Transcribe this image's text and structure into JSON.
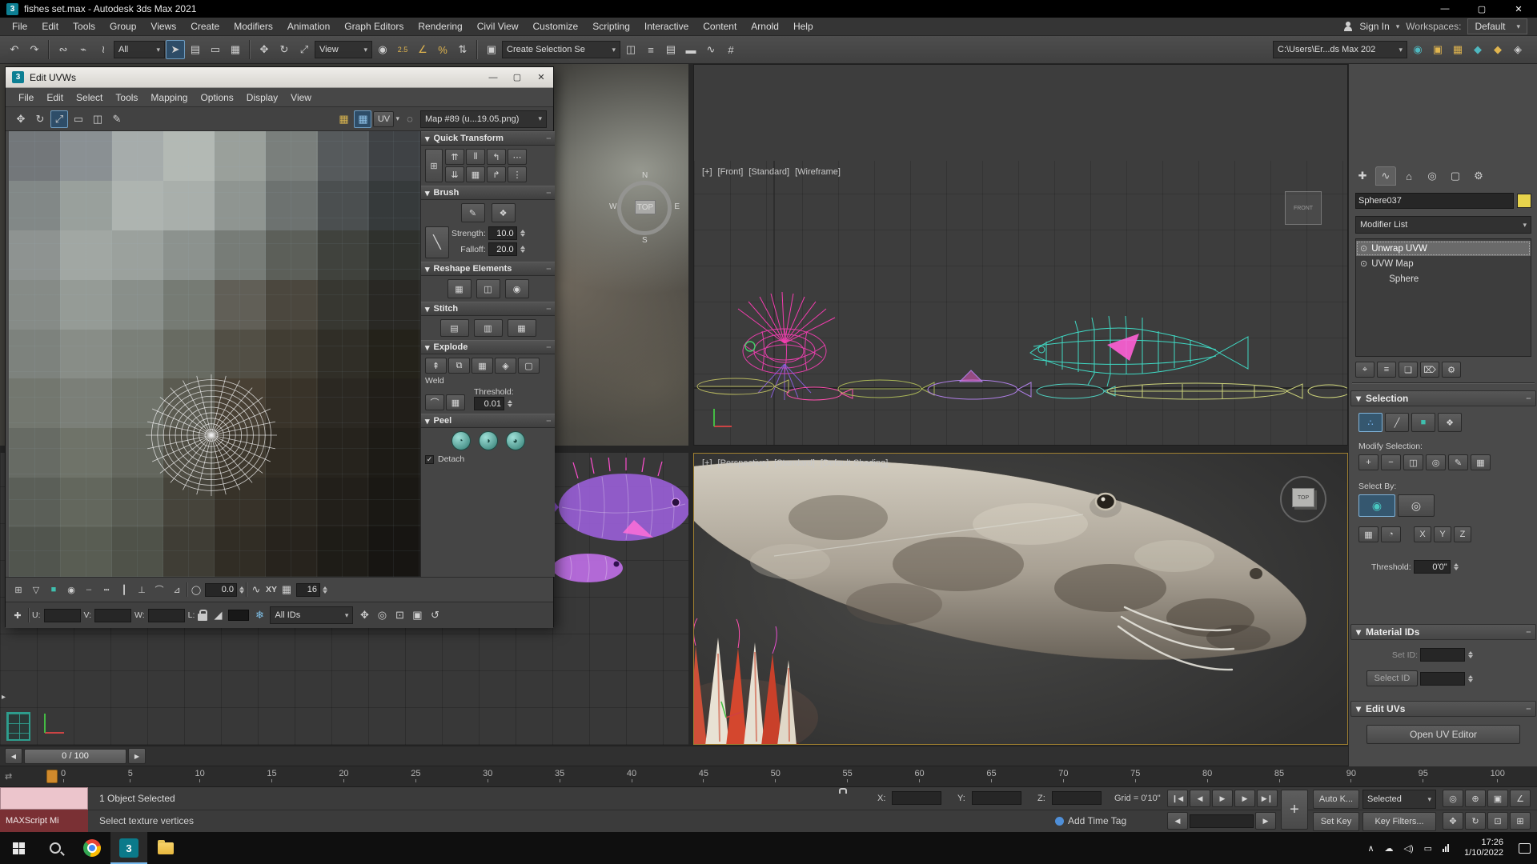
{
  "ui": {
    "caret": "▾",
    "collapse": "▾",
    "grip": "┉",
    "check": "✓",
    "pipe": "|",
    "ruler_grip": "⇄",
    "plus": "+"
  },
  "titlebar": {
    "logo_badge": "3",
    "app_title": "fishes set.max - Autodesk 3ds Max 2021",
    "controls": [
      {
        "name": "minimize-button",
        "glyph": "—"
      },
      {
        "name": "maximize-button",
        "glyph": "▢"
      },
      {
        "name": "close-button",
        "glyph": "✕"
      }
    ]
  },
  "menubar": {
    "items": [
      "File",
      "Edit",
      "Tools",
      "Group",
      "Views",
      "Create",
      "Modifiers",
      "Animation",
      "Graph Editors",
      "Rendering",
      "Civil View",
      "Customize",
      "Scripting",
      "Interactive",
      "Content",
      "Arnold",
      "Help"
    ],
    "sign_in": "Sign In",
    "workspaces_label": "Workspaces:",
    "workspace_value": "Default"
  },
  "main_toolbar": {
    "s1": [
      {
        "name": "undo-icon",
        "glyph": "↶"
      },
      {
        "name": "redo-icon",
        "glyph": "↷"
      }
    ],
    "s2": [
      {
        "name": "select-and-link-icon",
        "glyph": "∾"
      },
      {
        "name": "unlink-selection-icon",
        "glyph": "⌁"
      },
      {
        "name": "bind-to-space-warp-icon",
        "glyph": "≀"
      }
    ],
    "filter_value": "All",
    "s3": [
      {
        "name": "select-object-icon",
        "glyph": "➤",
        "active": true
      },
      {
        "name": "select-by-name-icon",
        "glyph": "▤"
      },
      {
        "name": "rectangular-selection-icon",
        "glyph": "▭"
      },
      {
        "name": "window-crossing-icon",
        "glyph": "▦"
      }
    ],
    "s4": [
      {
        "name": "select-and-move-icon",
        "glyph": "✥"
      },
      {
        "name": "select-and-rotate-icon",
        "glyph": "↻"
      },
      {
        "name": "select-and-scale-icon",
        "glyph": "⤢"
      }
    ],
    "coord_value": "View",
    "s5": [
      {
        "name": "use-pivot-center-icon",
        "glyph": "◉"
      },
      {
        "name": "snap-toggle-icon",
        "glyph": "2.5",
        "small": true,
        "color": "#e0b54f"
      },
      {
        "name": "angle-snap-icon",
        "glyph": "∠",
        "color": "#e0b54f"
      },
      {
        "name": "percent-snap-icon",
        "glyph": "%",
        "color": "#e0b54f"
      },
      {
        "name": "spinner-snap-icon",
        "glyph": "⇅"
      }
    ],
    "s6": [
      {
        "name": "edit-named-selections-icon",
        "glyph": "▣"
      }
    ],
    "named_selection_value": "Create Selection Se",
    "s7": [
      {
        "name": "mirror-icon",
        "glyph": "◫"
      },
      {
        "name": "align-icon",
        "glyph": "≡"
      },
      {
        "name": "layer-manager-icon",
        "glyph": "▤"
      },
      {
        "name": "toggle-ribbon-icon",
        "glyph": "▬"
      },
      {
        "name": "curve-editor-icon",
        "glyph": "∿"
      },
      {
        "name": "schematic-view-icon",
        "glyph": "#"
      }
    ],
    "project_path": "C:\\Users\\Er...ds Max 202",
    "s8": [
      {
        "name": "material-editor-icon",
        "glyph": "◉",
        "color": "#4fb8c0"
      },
      {
        "name": "render-setup-icon",
        "glyph": "▣",
        "color": "#e0b54f"
      },
      {
        "name": "rendered-frame-icon",
        "glyph": "▦",
        "color": "#e0b54f"
      },
      {
        "name": "render-production-icon",
        "glyph": "◆",
        "color": "#4fb8c0"
      },
      {
        "name": "render-iterative-icon",
        "glyph": "◆",
        "color": "#e0b54f"
      },
      {
        "name": "open-arnold-icon",
        "glyph": "◈"
      }
    ]
  },
  "viewports": {
    "front_tokens": [
      "[+]",
      "[Front]",
      "[Standard]",
      "[Wireframe]"
    ],
    "persp_tokens": [
      "[+]",
      "[Perspective]",
      "[Standard]",
      "[Default Shading]"
    ],
    "compass": {
      "n": "N",
      "e": "E",
      "s": "S",
      "w": "W",
      "hub": "TOP"
    },
    "viewcube_front": "FRONT",
    "viewcube_top": "TOP"
  },
  "uv_canvas": {
    "pixels": [
      "#73777a",
      "#8a9093",
      "#a6acab",
      "#b3b9b4",
      "#9aa09b",
      "#7a7f7c",
      "#565a5c",
      "#3f4245",
      "#828887",
      "#99a09c",
      "#aeb4b0",
      "#a9afab",
      "#8f9591",
      "#6d7270",
      "#4b4f50",
      "#363a3b",
      "#8e9391",
      "#a1a7a3",
      "#9ba19d",
      "#8c928e",
      "#777c77",
      "#5c5f59",
      "#40423d",
      "#2f312d",
      "#868b87",
      "#959b96",
      "#898f8a",
      "#767b74",
      "#615f57",
      "#4b473e",
      "#373731",
      "#292824",
      "#7d827d",
      "#888d87",
      "#7b8079",
      "#686b62",
      "#524f45",
      "#413d33",
      "#302e27",
      "#24221a",
      "#73776f",
      "#7b7f78",
      "#6f736a",
      "#5b5b51",
      "#484034",
      "#393329",
      "#2b2822",
      "#211e19",
      "#676b64",
      "#6f7369",
      "#63665d",
      "#4f4d43",
      "#3e382d",
      "#312c23",
      "#26231d",
      "#1d1b16",
      "#5b5f58",
      "#63675d",
      "#585b52",
      "#46443b",
      "#373229",
      "#2b2720",
      "#221f1a",
      "#1a1814",
      "#51554e",
      "#595d53",
      "#4f5249",
      "#3f3d35",
      "#312d25",
      "#27231d",
      "#1e1c17",
      "#171512"
    ]
  },
  "uv_editor": {
    "window_title": "Edit UVWs",
    "logo_badge": "3",
    "window_controls": [
      {
        "name": "uvw-minimize-button",
        "glyph": "—"
      },
      {
        "name": "uvw-maximize-button",
        "glyph": "▢"
      },
      {
        "name": "uvw-close-button",
        "glyph": "✕"
      }
    ],
    "menu_items": [
      "File",
      "Edit",
      "Select",
      "Tools",
      "Mapping",
      "Options",
      "Display",
      "View"
    ],
    "toolbar": {
      "left_icons": [
        {
          "name": "uv-move-icon",
          "glyph": "✥"
        },
        {
          "name": "uv-rotate-icon",
          "glyph": "↻"
        },
        {
          "name": "uv-scale-icon",
          "glyph": "⤢",
          "active": true
        },
        {
          "name": "uv-freeform-icon",
          "glyph": "▭"
        },
        {
          "name": "uv-mirror-icon",
          "glyph": "◫"
        },
        {
          "name": "uv-brush-icon",
          "glyph": "✎"
        }
      ],
      "right_icons": [
        {
          "name": "show-map-icon",
          "glyph": "▦",
          "color": "#d8b44f"
        },
        {
          "name": "snap-grid-icon",
          "glyph": "▦",
          "active": true,
          "color": "#8fc2e8"
        }
      ],
      "uv_button": "UV",
      "lasso_glyph": "◌",
      "map_value": "Map #89 (u...19.05.png)"
    },
    "rollouts": {
      "quick_transform": {
        "title": "Quick Transform",
        "tool_button": {
          "name": "align-selector-button",
          "glyph": "⊞"
        },
        "buttons": [
          {
            "name": "align-horizontal-button",
            "glyph": "⇈"
          },
          {
            "name": "space-horizontal-button",
            "glyph": "⫴"
          },
          {
            "name": "rotate-ccw-button",
            "glyph": "↰"
          },
          {
            "name": "linear-align-h-button",
            "glyph": "⋯"
          },
          {
            "name": "align-vertical-button",
            "glyph": "⇊"
          },
          {
            "name": "space-vertical-button",
            "glyph": "▦"
          },
          {
            "name": "rotate-cw-button",
            "glyph": "↱"
          },
          {
            "name": "linear-align-v-button",
            "glyph": "⋮"
          }
        ]
      },
      "brush": {
        "title": "Brush",
        "buttons": [
          {
            "name": "paint-move-brush-button",
            "glyph": "✎"
          },
          {
            "name": "relax-brush-button",
            "glyph": "❖"
          }
        ],
        "falloff_curve_glyph": "╲",
        "strength_label": "Strength:",
        "strength_value": "10.0",
        "falloff_label": "Falloff:",
        "falloff_value": "20.0"
      },
      "reshape": {
        "title": "Reshape Elements",
        "buttons": [
          {
            "name": "straighten-selection-button",
            "glyph": "▦"
          },
          {
            "name": "make-rectangular-button",
            "glyph": "◫"
          },
          {
            "name": "relax-until-flat-button",
            "glyph": "◉"
          }
        ]
      },
      "stitch": {
        "title": "Stitch",
        "buttons": [
          {
            "name": "stitch-custom-button",
            "glyph": "▤"
          },
          {
            "name": "stitch-to-target-button",
            "glyph": "▥"
          },
          {
            "name": "stitch-to-source-button",
            "glyph": "▦"
          }
        ]
      },
      "explode": {
        "title": "Explode",
        "buttons": [
          {
            "name": "flatten-by-smoothing-button",
            "glyph": "⇞"
          },
          {
            "name": "flatten-by-id-button",
            "glyph": "⧉"
          },
          {
            "name": "flatten-mapping-button",
            "glyph": "▦"
          },
          {
            "name": "explode-to-faces-button",
            "glyph": "◈"
          },
          {
            "name": "break-button",
            "glyph": "▢"
          }
        ],
        "weld_label": "Weld",
        "weld_buttons": [
          {
            "name": "weld-together-button",
            "glyph": "⌒"
          },
          {
            "name": "weld-all-button",
            "glyph": "▦"
          }
        ],
        "threshold_label": "Threshold:",
        "threshold_value": "0.01"
      },
      "peel": {
        "title": "Peel",
        "buttons": [
          {
            "name": "quick-peel-button",
            "glyph": "◔"
          },
          {
            "name": "peel-mode-button",
            "glyph": "◑"
          },
          {
            "name": "edit-seams-button",
            "glyph": "◕"
          }
        ],
        "detach_checked": "✓",
        "detach_label": "Detach"
      }
    },
    "bottom_toolbar": {
      "icons": [
        {
          "name": "soft-selection-icon",
          "glyph": "⊞"
        },
        {
          "name": "falloff-linear-icon",
          "glyph": "▽"
        },
        {
          "name": "falloff-box-icon",
          "glyph": "■",
          "color": "#3fbfae"
        },
        {
          "name": "falloff-smooth-icon",
          "glyph": "◉"
        },
        {
          "name": "edge-distance-icon",
          "glyph": "┄"
        },
        {
          "name": "limit-soft-selection-icon",
          "glyph": "┅"
        },
        {
          "name": "mirror-axis-icon",
          "glyph": "┃"
        },
        {
          "name": "align-perpendicular-icon",
          "glyph": "⊥"
        },
        {
          "name": "arc-mode-icon",
          "glyph": "⌒"
        },
        {
          "name": "angle-mode-icon",
          "glyph": "⊿"
        }
      ],
      "circle_glyph": "◯",
      "angle_value": "0.0",
      "curve_glyph": "∿",
      "axis_label": "XY",
      "grid_glyph": "▦",
      "grid_value": "16"
    },
    "status_row": {
      "move_glyph": "✚",
      "u_label": "U:",
      "u_value": "",
      "v_label": "V:",
      "v_value": "",
      "w_label": "W:",
      "w_value": "",
      "l_label": "L:",
      "gradient_glyph": "◢",
      "snow_glyph": "❄",
      "ids_value": "All IDs",
      "nav_icons": [
        {
          "name": "uv-pan-icon",
          "glyph": "✥"
        },
        {
          "name": "uv-zoom-icon",
          "glyph": "◎"
        },
        {
          "name": "uv-zoom-region-icon",
          "glyph": "⊡"
        },
        {
          "name": "uv-zoom-extents-icon",
          "glyph": "▣"
        },
        {
          "name": "uv-zoom-selected-icon",
          "glyph": "↺"
        }
      ]
    }
  },
  "command_panel": {
    "tabs": [
      {
        "name": "tab-create",
        "glyph": "✚"
      },
      {
        "name": "tab-modify",
        "glyph": "∿",
        "active": true
      },
      {
        "name": "tab-hierarchy",
        "glyph": "⌂"
      },
      {
        "name": "tab-motion",
        "glyph": "◎"
      },
      {
        "name": "tab-display",
        "glyph": "▢"
      },
      {
        "name": "tab-utilities",
        "glyph": "⚙"
      }
    ],
    "object_name": "Sphere037",
    "modifier_list_label": "Modifier List",
    "stack": [
      {
        "name": "stack-row-unwrap-uvw",
        "label": "Unwrap UVW",
        "eye": true,
        "active": true
      },
      {
        "name": "stack-row-uvw-map",
        "label": "UVW Map",
        "eye": true
      },
      {
        "name": "stack-row-sphere",
        "label": "Sphere",
        "indent": true
      }
    ],
    "stack_tools": [
      {
        "name": "pin-stack-icon",
        "glyph": "⌖"
      },
      {
        "name": "show-end-result-icon",
        "glyph": "≡"
      },
      {
        "name": "make-unique-icon",
        "glyph": "❏"
      },
      {
        "name": "remove-modifier-icon",
        "glyph": "⌦"
      },
      {
        "name": "configure-modifier-sets-icon",
        "glyph": "⚙"
      }
    ],
    "selection": {
      "title": "Selection",
      "mode_buttons": [
        {
          "name": "vertex-mode-button",
          "glyph": "∴",
          "active": true,
          "color": "#7fc0ff"
        },
        {
          "name": "edge-mode-button",
          "glyph": "╱"
        },
        {
          "name": "polygon-mode-button",
          "glyph": "■",
          "color": "#3fbfae"
        },
        {
          "name": "element-mode-button",
          "glyph": "❖"
        }
      ],
      "modify_label": "Modify Selection:",
      "modify_buttons": [
        {
          "name": "grow-selection-button",
          "glyph": "+"
        },
        {
          "name": "shrink-selection-button",
          "glyph": "−"
        },
        {
          "name": "loop-selection-button",
          "glyph": "◫"
        },
        {
          "name": "ring-selection-button",
          "glyph": "◎"
        },
        {
          "name": "paint-select-button",
          "glyph": "✎"
        },
        {
          "name": "convert-selection-button",
          "glyph": "▦"
        }
      ],
      "select_by_label": "Select By:",
      "by_buttons": [
        {
          "name": "select-by-element-toggle",
          "glyph": "◉",
          "active": true,
          "color": "#49c7c0"
        },
        {
          "name": "planar-angle-toggle",
          "glyph": "◎"
        }
      ],
      "extra_buttons": [
        {
          "name": "select-by-smoothing-button",
          "glyph": "▦"
        },
        {
          "name": "select-by-material-button",
          "glyph": "◔"
        }
      ],
      "axis_buttons": [
        {
          "name": "axis-x-button",
          "label": "X"
        },
        {
          "name": "axis-y-button",
          "label": "Y"
        },
        {
          "name": "axis-z-button",
          "label": "Z"
        }
      ],
      "threshold_label": "Threshold:",
      "threshold_value": "0'0\""
    },
    "material_ids": {
      "title": "Material IDs",
      "set_id_label": "Set ID:",
      "set_id_value": "",
      "select_id_label": "Select ID",
      "select_id_value": ""
    },
    "edit_uvs": {
      "title": "Edit UVs",
      "open_button": "Open UV Editor"
    }
  },
  "timeline": {
    "slider_value": "0 / 100",
    "ticks": [
      "0",
      "5",
      "10",
      "15",
      "20",
      "25",
      "30",
      "35",
      "40",
      "45",
      "50",
      "55",
      "60",
      "65",
      "70",
      "75",
      "80",
      "85",
      "90",
      "95",
      "100"
    ]
  },
  "status_bar": {
    "row1": {
      "selected_text": "1 Object Selected",
      "x_label": "X:",
      "x_value": "",
      "y_label": "Y:",
      "y_value": "",
      "z_label": "Z:",
      "z_value": "",
      "grid_text": "Grid = 0'10\"",
      "auto_key_label": "Auto K...",
      "selection_set_value": "Selected"
    },
    "row2": {
      "maxscript_label": "MAXScript Mi",
      "prompt": "Select texture vertices",
      "add_time_tag": "Add Time Tag",
      "set_key_label": "Set Key",
      "key_filters_label": "Key Filters..."
    },
    "transport": [
      {
        "name": "go-to-start-button",
        "glyph": "❙◀"
      },
      {
        "name": "previous-frame-button",
        "glyph": "◀"
      },
      {
        "name": "play-button",
        "glyph": "▶"
      },
      {
        "name": "next-frame-button",
        "glyph": "▶"
      },
      {
        "name": "go-to-end-button",
        "glyph": "▶❙"
      }
    ],
    "transport2_prev": "◀",
    "transport2_next": "▶",
    "time_field_value": "",
    "set_keys_glyph": "+",
    "nav_row1": [
      {
        "name": "zoom-icon",
        "glyph": "◎"
      },
      {
        "name": "zoom-all-icon",
        "glyph": "⊕"
      },
      {
        "name": "zoom-extents-icon",
        "glyph": "▣"
      },
      {
        "name": "fov-icon",
        "glyph": "∠"
      }
    ],
    "nav_row2": [
      {
        "name": "pan-icon",
        "glyph": "✥"
      },
      {
        "name": "orbit-icon",
        "glyph": "↻"
      },
      {
        "name": "zoom-region-icon",
        "glyph": "⊡"
      },
      {
        "name": "maximize-viewport-icon",
        "glyph": "⊞"
      }
    ]
  },
  "taskbar": {
    "max_badge": "3",
    "tray": [
      {
        "name": "hidden-icons-chevron",
        "glyph": "∧"
      },
      {
        "name": "onedrive-icon",
        "glyph": "☁"
      },
      {
        "name": "volume-icon",
        "glyph": "◁)"
      },
      {
        "name": "battery-icon",
        "glyph": "▭"
      }
    ],
    "time": "17:26",
    "date": "1/10/2022"
  }
}
